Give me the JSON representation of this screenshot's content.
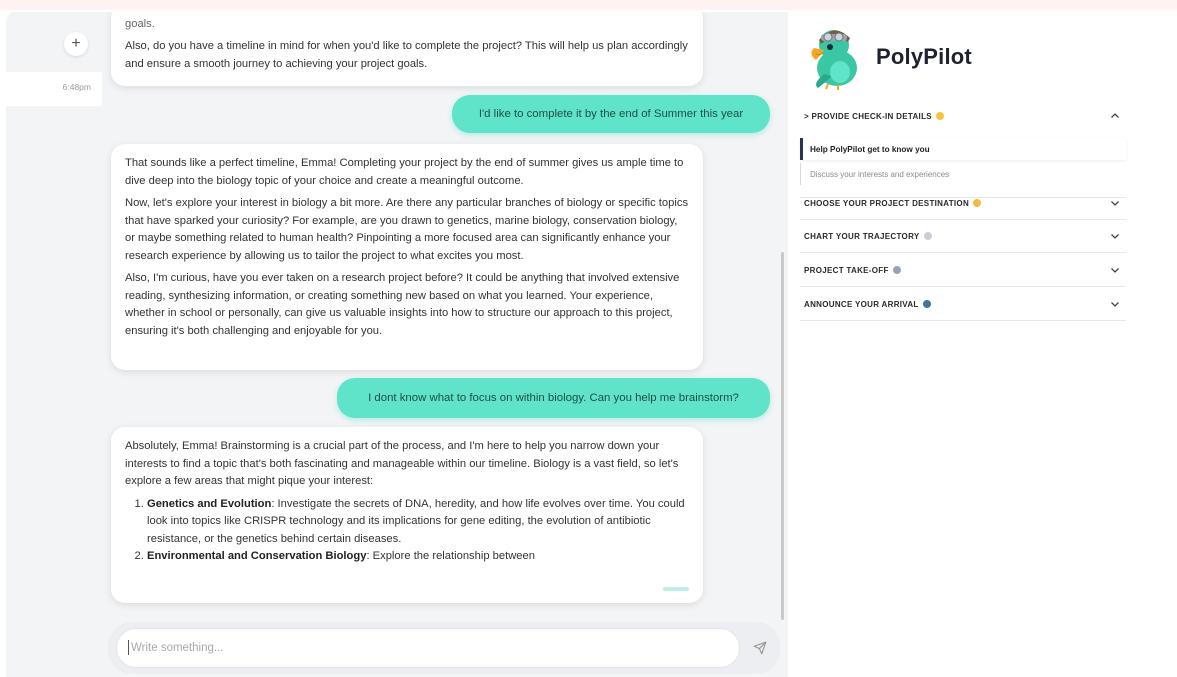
{
  "sidebar": {
    "new_chat_symbol": "+",
    "session_time": "6:48pm"
  },
  "chat": {
    "messages": [
      {
        "role": "assistant",
        "paragraphs": [
          "Understanding what fascinates you about biology will help us tailor this project to align with your passions and goals.",
          "Also, do you have a timeline in mind for when you'd like to complete the project? This will help us plan accordingly and ensure a smooth journey to achieving your project goals."
        ]
      },
      {
        "role": "user",
        "text": "I'd like to complete it by the end of Summer this year"
      },
      {
        "role": "assistant",
        "paragraphs": [
          "That sounds like a perfect timeline, Emma! Completing your project by the end of summer gives us ample time to dive deep into the biology topic of your choice and create a meaningful outcome.",
          "Now, let's explore your interest in biology a bit more. Are there any particular branches of biology or specific topics that have sparked your curiosity? For example, are you drawn to genetics, marine biology, conservation biology, or maybe something related to human health? Pinpointing a more focused area can significantly enhance your research experience by allowing us to tailor the project to what excites you most.",
          "Also, I'm curious, have you ever taken on a research project before? It could be anything that involved extensive reading, synthesizing information, or creating something new based on what you learned. Your experience, whether in school or personally, can give us valuable insights into how to structure our approach to this project, ensuring it's both challenging and enjoyable for you."
        ]
      },
      {
        "role": "user",
        "text": "I dont know what to focus on within biology. Can you help me brainstorm?"
      },
      {
        "role": "assistant",
        "intro": "Absolutely, Emma! Brainstorming is a crucial part of the process, and I'm here to help you narrow down your interests to find a topic that's both fascinating and manageable within our timeline. Biology is a vast field, so let's explore a few areas that might pique your interest:",
        "list": [
          {
            "title": "Genetics and Evolution",
            "text": ": Investigate the secrets of DNA, heredity, and how life evolves over time. You could look into topics like CRISPR technology and its implications for gene editing, the evolution of antibiotic resistance, or the genetics behind certain diseases."
          },
          {
            "title": "Environmental and Conservation Biology",
            "text": ": Explore the relationship between"
          }
        ]
      }
    ],
    "composer": {
      "placeholder": "Write something..."
    }
  },
  "panel": {
    "brand": "PolyPilot",
    "sections": [
      {
        "title": "> PROVIDE CHECK-IN DETAILS",
        "expanded": true,
        "emoji_color": "#f5c542",
        "items": [
          {
            "label": "Help PolyPilot get to know you",
            "active": true
          },
          {
            "label": "Discuss your interests and experiences",
            "active": false
          }
        ]
      },
      {
        "title": "CHOOSE YOUR PROJECT DESTINATION",
        "expanded": false,
        "emoji_color": "#f5b942"
      },
      {
        "title": "CHART YOUR TRAJECTORY",
        "expanded": false,
        "emoji_color": "#c9ced6"
      },
      {
        "title": "PROJECT TAKE-OFF",
        "expanded": false,
        "emoji_color": "#9aa3b5"
      },
      {
        "title": "ANNOUNCE YOUR ARRIVAL",
        "expanded": false,
        "emoji_color": "#4a6fa5"
      }
    ]
  },
  "colors": {
    "accent": "#5fe3c9",
    "active_marker": "#2c3550",
    "background": "#f3f4f6"
  },
  "icons": {
    "new_chat": "plus-icon",
    "send": "send-icon",
    "collapse": "chevron-up-icon",
    "expand": "chevron-down-icon",
    "logo": "parrot-pilot-icon"
  }
}
